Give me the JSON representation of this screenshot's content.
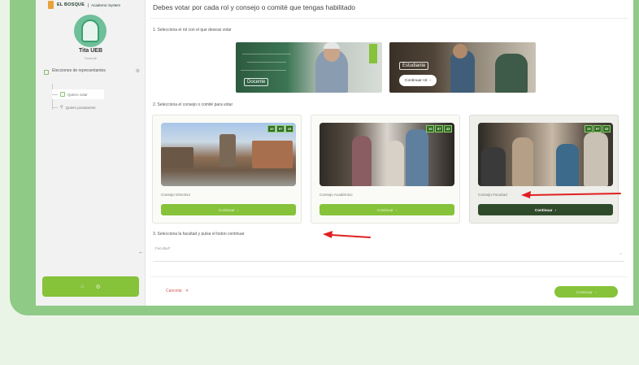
{
  "sidebar": {
    "logo_text": "EL BOSQUE",
    "logo_sub": "Academic System",
    "user_name": "Tita UEB",
    "user_role": "Docente",
    "menu_section": "Elecciones de representantes",
    "items": [
      {
        "label": "Quiero votar"
      },
      {
        "label": "Quiero postularme"
      }
    ],
    "collapse_icon": "arrow-left-icon",
    "footer_icons": [
      "home-icon",
      "settings-icon"
    ]
  },
  "main": {
    "title": "Debes votar por cada rol y consejo o comité que tengas habilitado",
    "step1": "1. Selecciona el rol con el que deseas votar",
    "step2": "2. Selecciona el consejo o comité para votar",
    "step3": "3. Selecciona la facultad y pulsa el boton continuar",
    "roles": [
      {
        "label": "Docente"
      },
      {
        "label": "Estudiante",
        "button": "Continuar rol"
      }
    ],
    "councils": [
      {
        "name": "Consejo Directivo",
        "button": "Continuar",
        "date": [
          "10",
          "07",
          "43"
        ]
      },
      {
        "name": "Consejo Académico",
        "button": "Continuar",
        "date": [
          "10",
          "07",
          "43"
        ]
      },
      {
        "name": "Consejo Facultad",
        "button": "Continuar",
        "date": [
          "10",
          "07",
          "43"
        ],
        "selected": true
      }
    ],
    "faculty_label": "Facultad*",
    "cancel_label": "Cancelar",
    "next_label": "Continuar"
  },
  "colors": {
    "accent": "#86c23a",
    "dark_button": "#2f4a2a",
    "frame": "#8fca86",
    "annotation_arrow": "#e02020"
  }
}
